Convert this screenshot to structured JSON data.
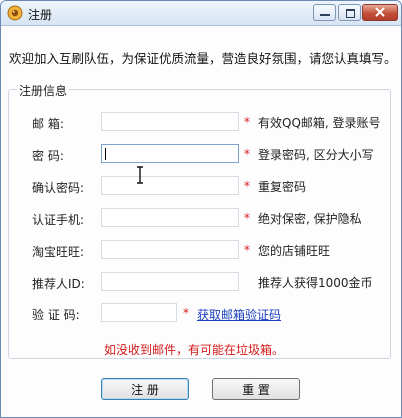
{
  "window": {
    "title": "注册"
  },
  "intro_text": "欢迎加入互刷队伍，为保证优质流量，营造良好氛围，请您认真填写。",
  "group_title": "注册信息",
  "fields": [
    {
      "label": "邮    箱:",
      "value": "",
      "required_mark": "*",
      "hint": "有效QQ邮箱, 登录账号"
    },
    {
      "label": "密    码:",
      "value": "",
      "required_mark": "*",
      "hint": "登录密码, 区分大小写"
    },
    {
      "label": "确认密码:",
      "value": "",
      "required_mark": "*",
      "hint": "重复密码"
    },
    {
      "label": "认证手机:",
      "value": "",
      "required_mark": "*",
      "hint": "绝对保密, 保护隐私"
    },
    {
      "label": "淘宝旺旺:",
      "value": "",
      "required_mark": "*",
      "hint": "您的店铺旺旺"
    },
    {
      "label": "推荐人ID:",
      "value": "",
      "required_mark": "",
      "hint": "推荐人获得1000金币"
    }
  ],
  "verification": {
    "label": "验 证 码:",
    "value": "",
    "required_mark": "*",
    "link_text": "获取邮箱验证码"
  },
  "notice": "如没收到邮件，有可能在垃圾箱。",
  "buttons": {
    "register": "注 册",
    "reset": "重 置"
  },
  "colors": {
    "required": "#d21b1b",
    "link": "#1a3fbf"
  }
}
